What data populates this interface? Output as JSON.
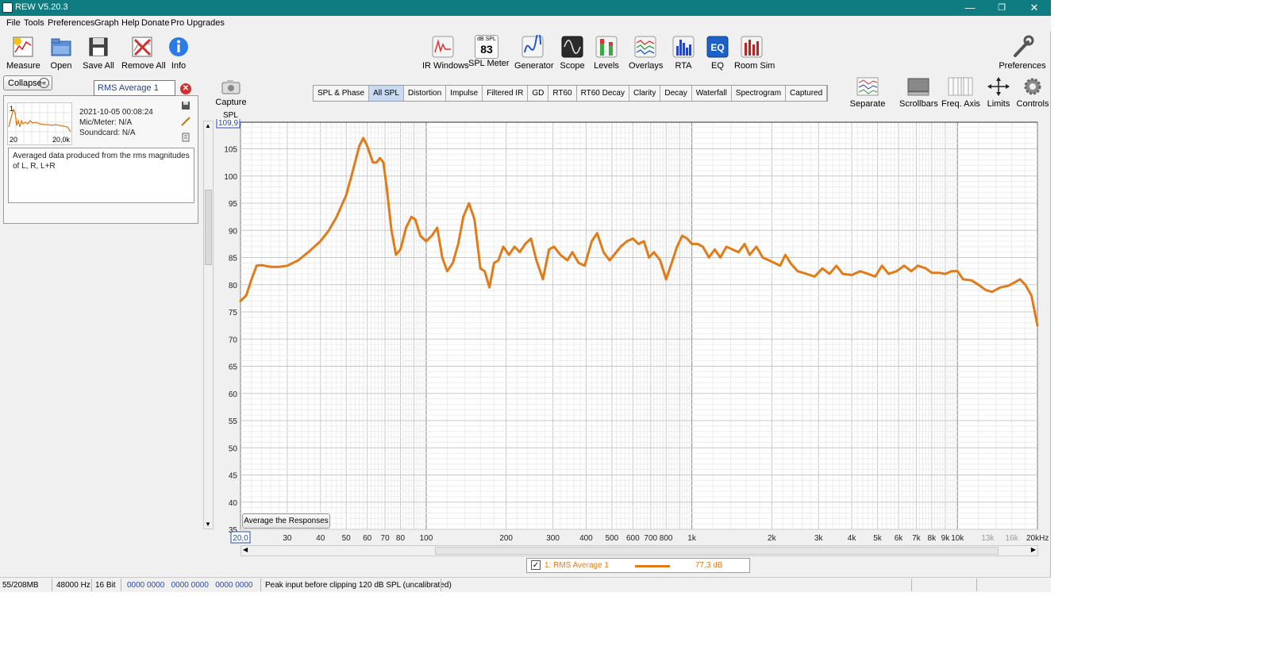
{
  "window": {
    "title": "REW V5.20.3",
    "minimize": "—",
    "maximize": "❐",
    "close": "✕"
  },
  "menu": [
    "File",
    "Tools",
    "Preferences",
    "Graph",
    "Help",
    "Donate",
    "Pro Upgrades"
  ],
  "toolbar_left": [
    {
      "label": "Measure",
      "icon": "measure-icon"
    },
    {
      "label": "Open",
      "icon": "folder-icon"
    },
    {
      "label": "Save All",
      "icon": "save-icon"
    },
    {
      "label": "Remove All",
      "icon": "remove-icon"
    },
    {
      "label": "Info",
      "icon": "info-icon"
    }
  ],
  "toolbar_center": [
    {
      "label": "IR Windows",
      "icon": "ir-windows-icon"
    },
    {
      "label": "SPL Meter",
      "icon": "spl-meter-icon",
      "readout_top": "dB SPL",
      "readout_value": "83"
    },
    {
      "label": "Generator",
      "icon": "generator-icon"
    },
    {
      "label": "Scope",
      "icon": "scope-icon"
    },
    {
      "label": "Levels",
      "icon": "levels-icon"
    },
    {
      "label": "Overlays",
      "icon": "overlays-icon"
    },
    {
      "label": "RTA",
      "icon": "rta-icon"
    },
    {
      "label": "EQ",
      "icon": "eq-icon"
    },
    {
      "label": "Room Sim",
      "icon": "room-sim-icon"
    }
  ],
  "toolbar_right": {
    "label": "Preferences",
    "icon": "wrench-icon"
  },
  "graph_tools": [
    {
      "label": "Separate",
      "icon": "separate-icon"
    },
    {
      "label": "Scrollbars",
      "icon": "scrollbars-icon"
    },
    {
      "label": "Freq. Axis",
      "icon": "freq-axis-icon"
    },
    {
      "label": "Limits",
      "icon": "limits-icon"
    },
    {
      "label": "Controls",
      "icon": "gear-icon"
    }
  ],
  "left_panel": {
    "collapse_label": "Collapse",
    "collapse_icon": "«",
    "measurement_name": "RMS Average 1",
    "index": "1",
    "date": "2021-10-05 00:08:24",
    "mic": "Mic/Meter: N/A",
    "soundcard": "Soundcard: N/A",
    "thumb_left": "20",
    "thumb_right": "20,0k",
    "notes": "Averaged data produced from the rms magnitudes of L, R, L+R"
  },
  "capture": {
    "label": "Capture"
  },
  "tabs": [
    "SPL & Phase",
    "All SPL",
    "Distortion",
    "Impulse",
    "Filtered IR",
    "GD",
    "RT60",
    "RT60 Decay",
    "Clarity",
    "Decay",
    "Waterfall",
    "Spectrogram",
    "Captured"
  ],
  "active_tab": "All SPL",
  "average_button": "Average the Responses",
  "legend": {
    "checkbox": "✓",
    "name": "1: RMS Average 1",
    "value": "77,3 dB",
    "color": "#e07b18"
  },
  "status": {
    "memory": "55/208MB",
    "rate": "48000 Hz",
    "bits": "16 Bit",
    "inputs": "0000 0000   0000 0000   0000 0000",
    "message": "Peak input before clipping 120 dB SPL (uncalibrated)"
  },
  "chart_data": {
    "type": "line",
    "ylabel": "SPL",
    "ylim": [
      35,
      109.9
    ],
    "xlim": [
      20,
      20000
    ],
    "x_scale": "log",
    "y_cursor_label": "109,9",
    "x_cursor_label": "20,0",
    "yticks": [
      105,
      100,
      95,
      90,
      85,
      80,
      75,
      70,
      65,
      60,
      55,
      50,
      45,
      40,
      35
    ],
    "xticks": [
      {
        "value": 30,
        "label": "30"
      },
      {
        "value": 40,
        "label": "40"
      },
      {
        "value": 50,
        "label": "50"
      },
      {
        "value": 60,
        "label": "60"
      },
      {
        "value": 70,
        "label": "70"
      },
      {
        "value": 80,
        "label": "80"
      },
      {
        "value": 100,
        "label": "100"
      },
      {
        "value": 200,
        "label": "200"
      },
      {
        "value": 300,
        "label": "300"
      },
      {
        "value": 400,
        "label": "400"
      },
      {
        "value": 500,
        "label": "500"
      },
      {
        "value": 600,
        "label": "600"
      },
      {
        "value": 700,
        "label": "700"
      },
      {
        "value": 800,
        "label": "800"
      },
      {
        "value": 1000,
        "label": "1k"
      },
      {
        "value": 2000,
        "label": "2k"
      },
      {
        "value": 3000,
        "label": "3k"
      },
      {
        "value": 4000,
        "label": "4k"
      },
      {
        "value": 5000,
        "label": "5k"
      },
      {
        "value": 6000,
        "label": "6k"
      },
      {
        "value": 7000,
        "label": "7k"
      },
      {
        "value": 8000,
        "label": "8k"
      },
      {
        "value": 9000,
        "label": "9k"
      },
      {
        "value": 10000,
        "label": "10k"
      },
      {
        "value": 13000,
        "label": "13k"
      },
      {
        "value": 16000,
        "label": "16k"
      },
      {
        "value": 20000,
        "label": "20kHz"
      }
    ],
    "grid": true,
    "series": [
      {
        "name": "1: RMS Average 1",
        "color": "#e07b18",
        "points": [
          [
            20,
            77
          ],
          [
            21,
            78
          ],
          [
            22,
            81
          ],
          [
            23,
            83.5
          ],
          [
            24,
            83.6
          ],
          [
            26,
            83.3
          ],
          [
            28,
            83.3
          ],
          [
            30,
            83.5
          ],
          [
            33,
            84.5
          ],
          [
            36,
            86
          ],
          [
            40,
            88
          ],
          [
            43,
            90
          ],
          [
            46,
            92.5
          ],
          [
            50,
            96.5
          ],
          [
            53,
            101
          ],
          [
            56,
            105.5
          ],
          [
            58,
            107
          ],
          [
            60,
            105.5
          ],
          [
            63,
            102.5
          ],
          [
            65,
            102.5
          ],
          [
            67,
            103.3
          ],
          [
            69,
            102.5
          ],
          [
            71,
            98
          ],
          [
            74,
            90
          ],
          [
            77,
            85.5
          ],
          [
            80,
            86.5
          ],
          [
            84,
            90.5
          ],
          [
            88,
            92.5
          ],
          [
            91,
            92
          ],
          [
            95,
            89
          ],
          [
            100,
            88
          ],
          [
            105,
            89
          ],
          [
            110,
            90.5
          ],
          [
            115,
            85
          ],
          [
            120,
            82.5
          ],
          [
            126,
            84
          ],
          [
            132,
            87.5
          ],
          [
            138,
            92.5
          ],
          [
            145,
            95
          ],
          [
            152,
            92
          ],
          [
            160,
            83
          ],
          [
            166,
            82.5
          ],
          [
            173,
            79.5
          ],
          [
            180,
            84
          ],
          [
            187,
            84.5
          ],
          [
            195,
            87
          ],
          [
            205,
            85.5
          ],
          [
            215,
            87
          ],
          [
            225,
            86
          ],
          [
            236,
            87.5
          ],
          [
            248,
            88.5
          ],
          [
            260,
            84.5
          ],
          [
            275,
            81
          ],
          [
            290,
            86.5
          ],
          [
            303,
            87
          ],
          [
            320,
            85.5
          ],
          [
            340,
            84.5
          ],
          [
            355,
            86
          ],
          [
            375,
            84
          ],
          [
            395,
            83.5
          ],
          [
            420,
            88
          ],
          [
            440,
            89.5
          ],
          [
            465,
            86
          ],
          [
            490,
            84.5
          ],
          [
            510,
            85.5
          ],
          [
            540,
            87
          ],
          [
            570,
            88
          ],
          [
            600,
            88.5
          ],
          [
            630,
            87.5
          ],
          [
            660,
            88
          ],
          [
            690,
            85
          ],
          [
            720,
            86
          ],
          [
            760,
            84.5
          ],
          [
            800,
            81
          ],
          [
            840,
            84
          ],
          [
            880,
            87
          ],
          [
            920,
            89
          ],
          [
            960,
            88.5
          ],
          [
            1000,
            87.5
          ],
          [
            1050,
            87.5
          ],
          [
            1100,
            87
          ],
          [
            1160,
            85
          ],
          [
            1220,
            86.5
          ],
          [
            1280,
            85
          ],
          [
            1350,
            87
          ],
          [
            1420,
            86.5
          ],
          [
            1500,
            86
          ],
          [
            1580,
            87.5
          ],
          [
            1650,
            85.5
          ],
          [
            1750,
            87
          ],
          [
            1850,
            85
          ],
          [
            1950,
            84.5
          ],
          [
            2050,
            84
          ],
          [
            2150,
            83.5
          ],
          [
            2250,
            85.5
          ],
          [
            2350,
            84
          ],
          [
            2500,
            82.5
          ],
          [
            2700,
            82
          ],
          [
            2900,
            81.5
          ],
          [
            3100,
            83
          ],
          [
            3300,
            82
          ],
          [
            3500,
            83.5
          ],
          [
            3700,
            82
          ],
          [
            4000,
            81.8
          ],
          [
            4300,
            82.5
          ],
          [
            4600,
            82
          ],
          [
            4900,
            81.5
          ],
          [
            5200,
            83.5
          ],
          [
            5500,
            82
          ],
          [
            5900,
            82.5
          ],
          [
            6300,
            83.5
          ],
          [
            6700,
            82.5
          ],
          [
            7100,
            83.5
          ],
          [
            7600,
            83
          ],
          [
            8000,
            82.2
          ],
          [
            8500,
            82.2
          ],
          [
            9000,
            82
          ],
          [
            9500,
            82.5
          ],
          [
            10000,
            82.5
          ],
          [
            10500,
            81
          ],
          [
            11300,
            80.8
          ],
          [
            12000,
            80
          ],
          [
            12800,
            79
          ],
          [
            13500,
            78.7
          ],
          [
            14500,
            79.5
          ],
          [
            15500,
            79.8
          ],
          [
            16500,
            80.5
          ],
          [
            17200,
            81
          ],
          [
            18000,
            80
          ],
          [
            19000,
            78
          ],
          [
            20000,
            72.5
          ]
        ]
      }
    ]
  }
}
